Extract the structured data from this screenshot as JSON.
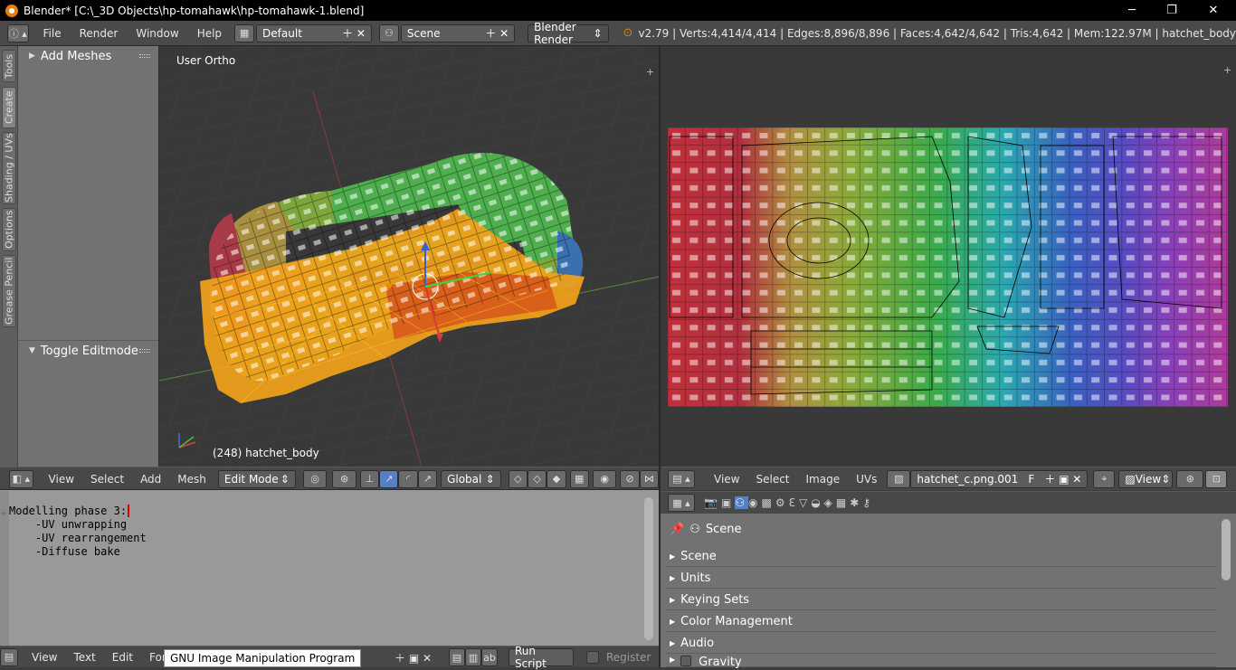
{
  "window": {
    "title": "Blender* [C:\\_3D Objects\\hp-tomahawk\\hp-tomahawk-1.blend]",
    "minimize": "─",
    "maximize": "❐",
    "close": "✕"
  },
  "info_header": {
    "menus": [
      "File",
      "Render",
      "Window",
      "Help"
    ],
    "screen_layout": "Default",
    "scene": "Scene",
    "render_engine": "Blender Render",
    "stats": "v2.79 | Verts:4,414/4,414 | Edges:8,896/8,896 | Faces:4,642/4,642 | Tris:4,642 | Mem:122.97M | hatchet_body"
  },
  "tool_shelf": {
    "tabs": [
      "Tools",
      "Create",
      "Shading / UVs",
      "Options",
      "Grease Pencil"
    ],
    "panels": [
      "Add Meshes",
      "Toggle Editmode"
    ]
  },
  "viewport3d": {
    "view_label": "User Ortho",
    "object_label": "(248) hatchet_body",
    "header": {
      "menus": [
        "View",
        "Select",
        "Add",
        "Mesh"
      ],
      "mode": "Edit Mode",
      "orientation": "Global"
    }
  },
  "uv_editor": {
    "header": {
      "menus": [
        "View",
        "Select",
        "Image",
        "UVs"
      ],
      "image_name": "hatchet_c.png.001",
      "fake_user": "F",
      "view_mode": "View"
    }
  },
  "text_editor": {
    "lines": [
      "Modelling phase 3:",
      "    -UV unwrapping",
      "    -UV rearrangement",
      "    -Diffuse bake"
    ],
    "header": {
      "menus": [
        "View",
        "Text",
        "Edit",
        "Form"
      ],
      "run_script": "Run Script",
      "register": "Register"
    },
    "tooltip": "GNU Image Manipulation Program"
  },
  "properties": {
    "context": "Scene",
    "panels": [
      "Scene",
      "Units",
      "Keying Sets",
      "Color Management",
      "Audio",
      "Gravity"
    ]
  },
  "colors": {
    "accent_orange": "#e87d0d",
    "selected_blue": "#5680c2"
  }
}
